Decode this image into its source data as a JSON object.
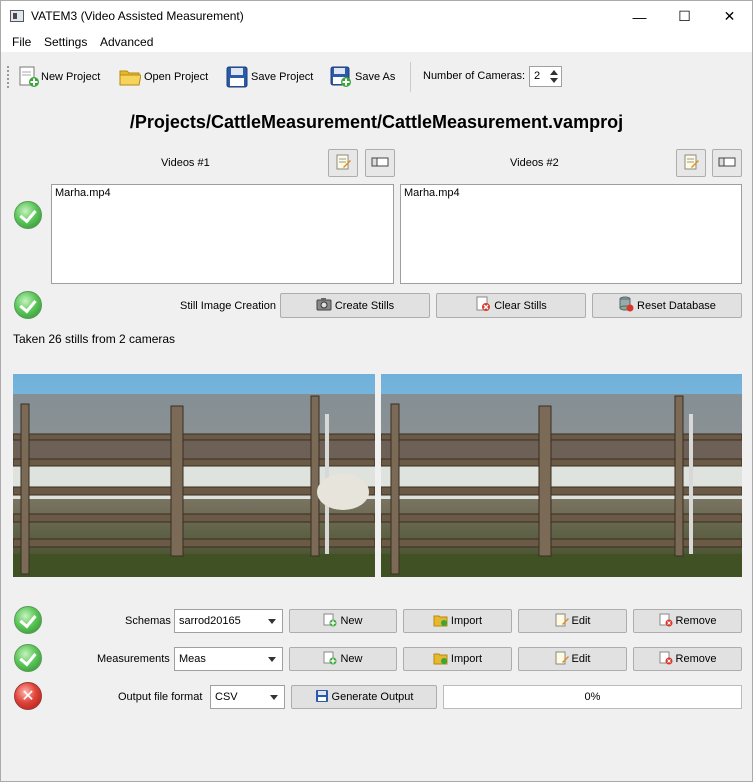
{
  "window": {
    "title": "VATEM3 (Video Assisted Measurement)",
    "minimize_glyph": "—",
    "maximize_glyph": "☐",
    "close_glyph": "✕"
  },
  "menu": [
    "File",
    "Settings",
    "Advanced"
  ],
  "toolbar": {
    "new_project": "New Project",
    "open_project": "Open Project",
    "save_project": "Save Project",
    "save_as": "Save As",
    "num_cameras_label": "Number of Cameras:",
    "num_cameras_value": "2"
  },
  "project_path": "/Projects/CattleMeasurement/CattleMeasurement.vamproj",
  "videos": [
    {
      "header": "Videos #1",
      "files": [
        "Marha.mp4"
      ]
    },
    {
      "header": "Videos #2",
      "files": [
        "Marha.mp4"
      ]
    }
  ],
  "stills": {
    "label": "Still Image Creation",
    "create": "Create Stills",
    "clear": "Clear Stills",
    "reset": "Reset Database",
    "status": "Taken 26 stills from 2 cameras"
  },
  "schemas": {
    "label": "Schemas",
    "selected": "sarrod20165",
    "new": "New",
    "import": "Import",
    "edit": "Edit",
    "remove": "Remove"
  },
  "measurements": {
    "label": "Measurements",
    "selected": "Meas",
    "new": "New",
    "import": "Import",
    "edit": "Edit",
    "remove": "Remove"
  },
  "output": {
    "label": "Output file format",
    "format": "CSV",
    "generate": "Generate Output",
    "progress": "0%",
    "progress_value": 0
  },
  "colors": {
    "ok_green": "#3aa63a",
    "error_red": "#d9372c",
    "sky": "#7fb6d8"
  },
  "icons": {
    "status_ok": "check-circle-icon",
    "status_error": "x-circle-icon"
  }
}
